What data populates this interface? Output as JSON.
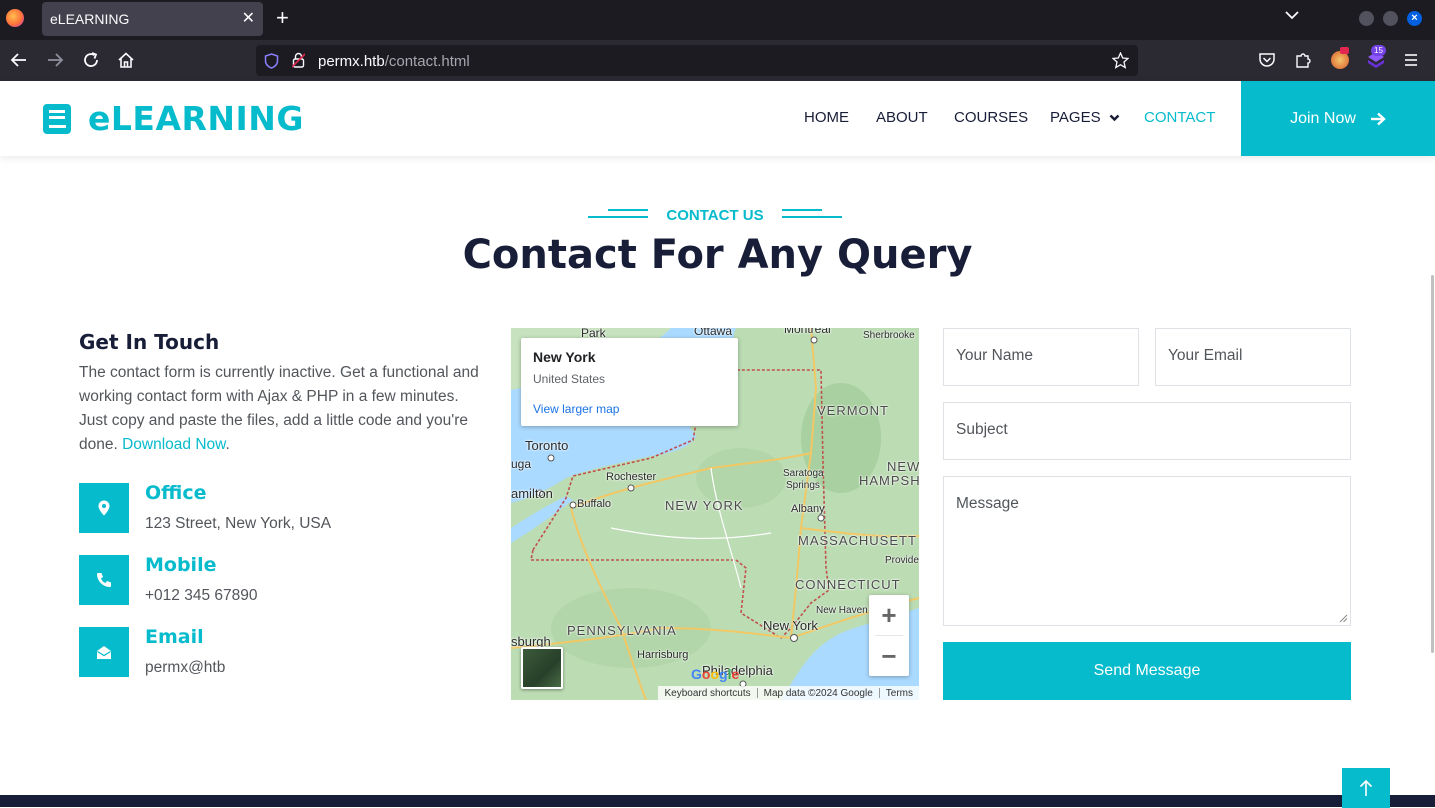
{
  "browser": {
    "tab_title": "eLEARNING",
    "url_host": "permx.htb",
    "url_path": "/contact.html",
    "extension_badge": "15"
  },
  "header": {
    "brand": "eLEARNING",
    "menu": [
      "HOME",
      "ABOUT",
      "COURSES",
      "PAGES",
      "CONTACT"
    ],
    "active_menu": "CONTACT",
    "join_label": "Join Now"
  },
  "section": {
    "eyebrow": "CONTACT US",
    "heading": "Contact For Any Query"
  },
  "get_in_touch": {
    "title": "Get In Touch",
    "text": "The contact form is currently inactive. Get a functional and working contact form with Ajax & PHP in a few minutes. Just copy and paste the files, add a little code and you're done.",
    "link": "Download Now",
    "after_link": "."
  },
  "contacts": [
    {
      "title": "Office",
      "value": "123 Street, New York, USA",
      "icon": "location-pin-icon"
    },
    {
      "title": "Mobile",
      "value": "+012 345 67890",
      "icon": "phone-icon"
    },
    {
      "title": "Email",
      "value": "permx@htb",
      "icon": "envelope-open-icon"
    }
  ],
  "map": {
    "card_title": "New York",
    "card_subtitle": "United States",
    "card_link": "View larger map",
    "labels": {
      "park": "Park",
      "ottawa": "Ottawa",
      "montreal": "Montreal",
      "sherbrooke": "Sherbrooke",
      "vermont": "VERMONT",
      "toronto": "Toronto",
      "uga": "uga",
      "rochester": "Rochester",
      "saratoga": "Saratoga",
      "springs": "Springs",
      "new_h": "NEW",
      "hampsh": "HAMPSH",
      "hamilton": "amilton",
      "buffalo": "Buffalo",
      "new_york_state": "NEW YORK",
      "albany": "Albany",
      "massachusetts": "MASSACHUSETT",
      "provide": "Provide",
      "connecticut": "CONNECTICUT",
      "new_haven": "New Haven",
      "sburgh": "sburgh",
      "pennsylvania": "PENNSYLVANIA",
      "new_york_city": "New York",
      "harrisburg": "Harrisburg",
      "philadelphia": "Philadelphia"
    },
    "zoom_in": "+",
    "zoom_out": "−",
    "google": "Google",
    "attribution": [
      "Keyboard shortcuts",
      "Map data ©2024 Google",
      "Terms"
    ]
  },
  "form": {
    "name_placeholder": "Your Name",
    "email_placeholder": "Your Email",
    "subject_placeholder": "Subject",
    "message_placeholder": "Message",
    "submit_label": "Send Message"
  },
  "colors": {
    "primary": "#06bbcc",
    "dark": "#181d38",
    "text": "#52565b"
  }
}
